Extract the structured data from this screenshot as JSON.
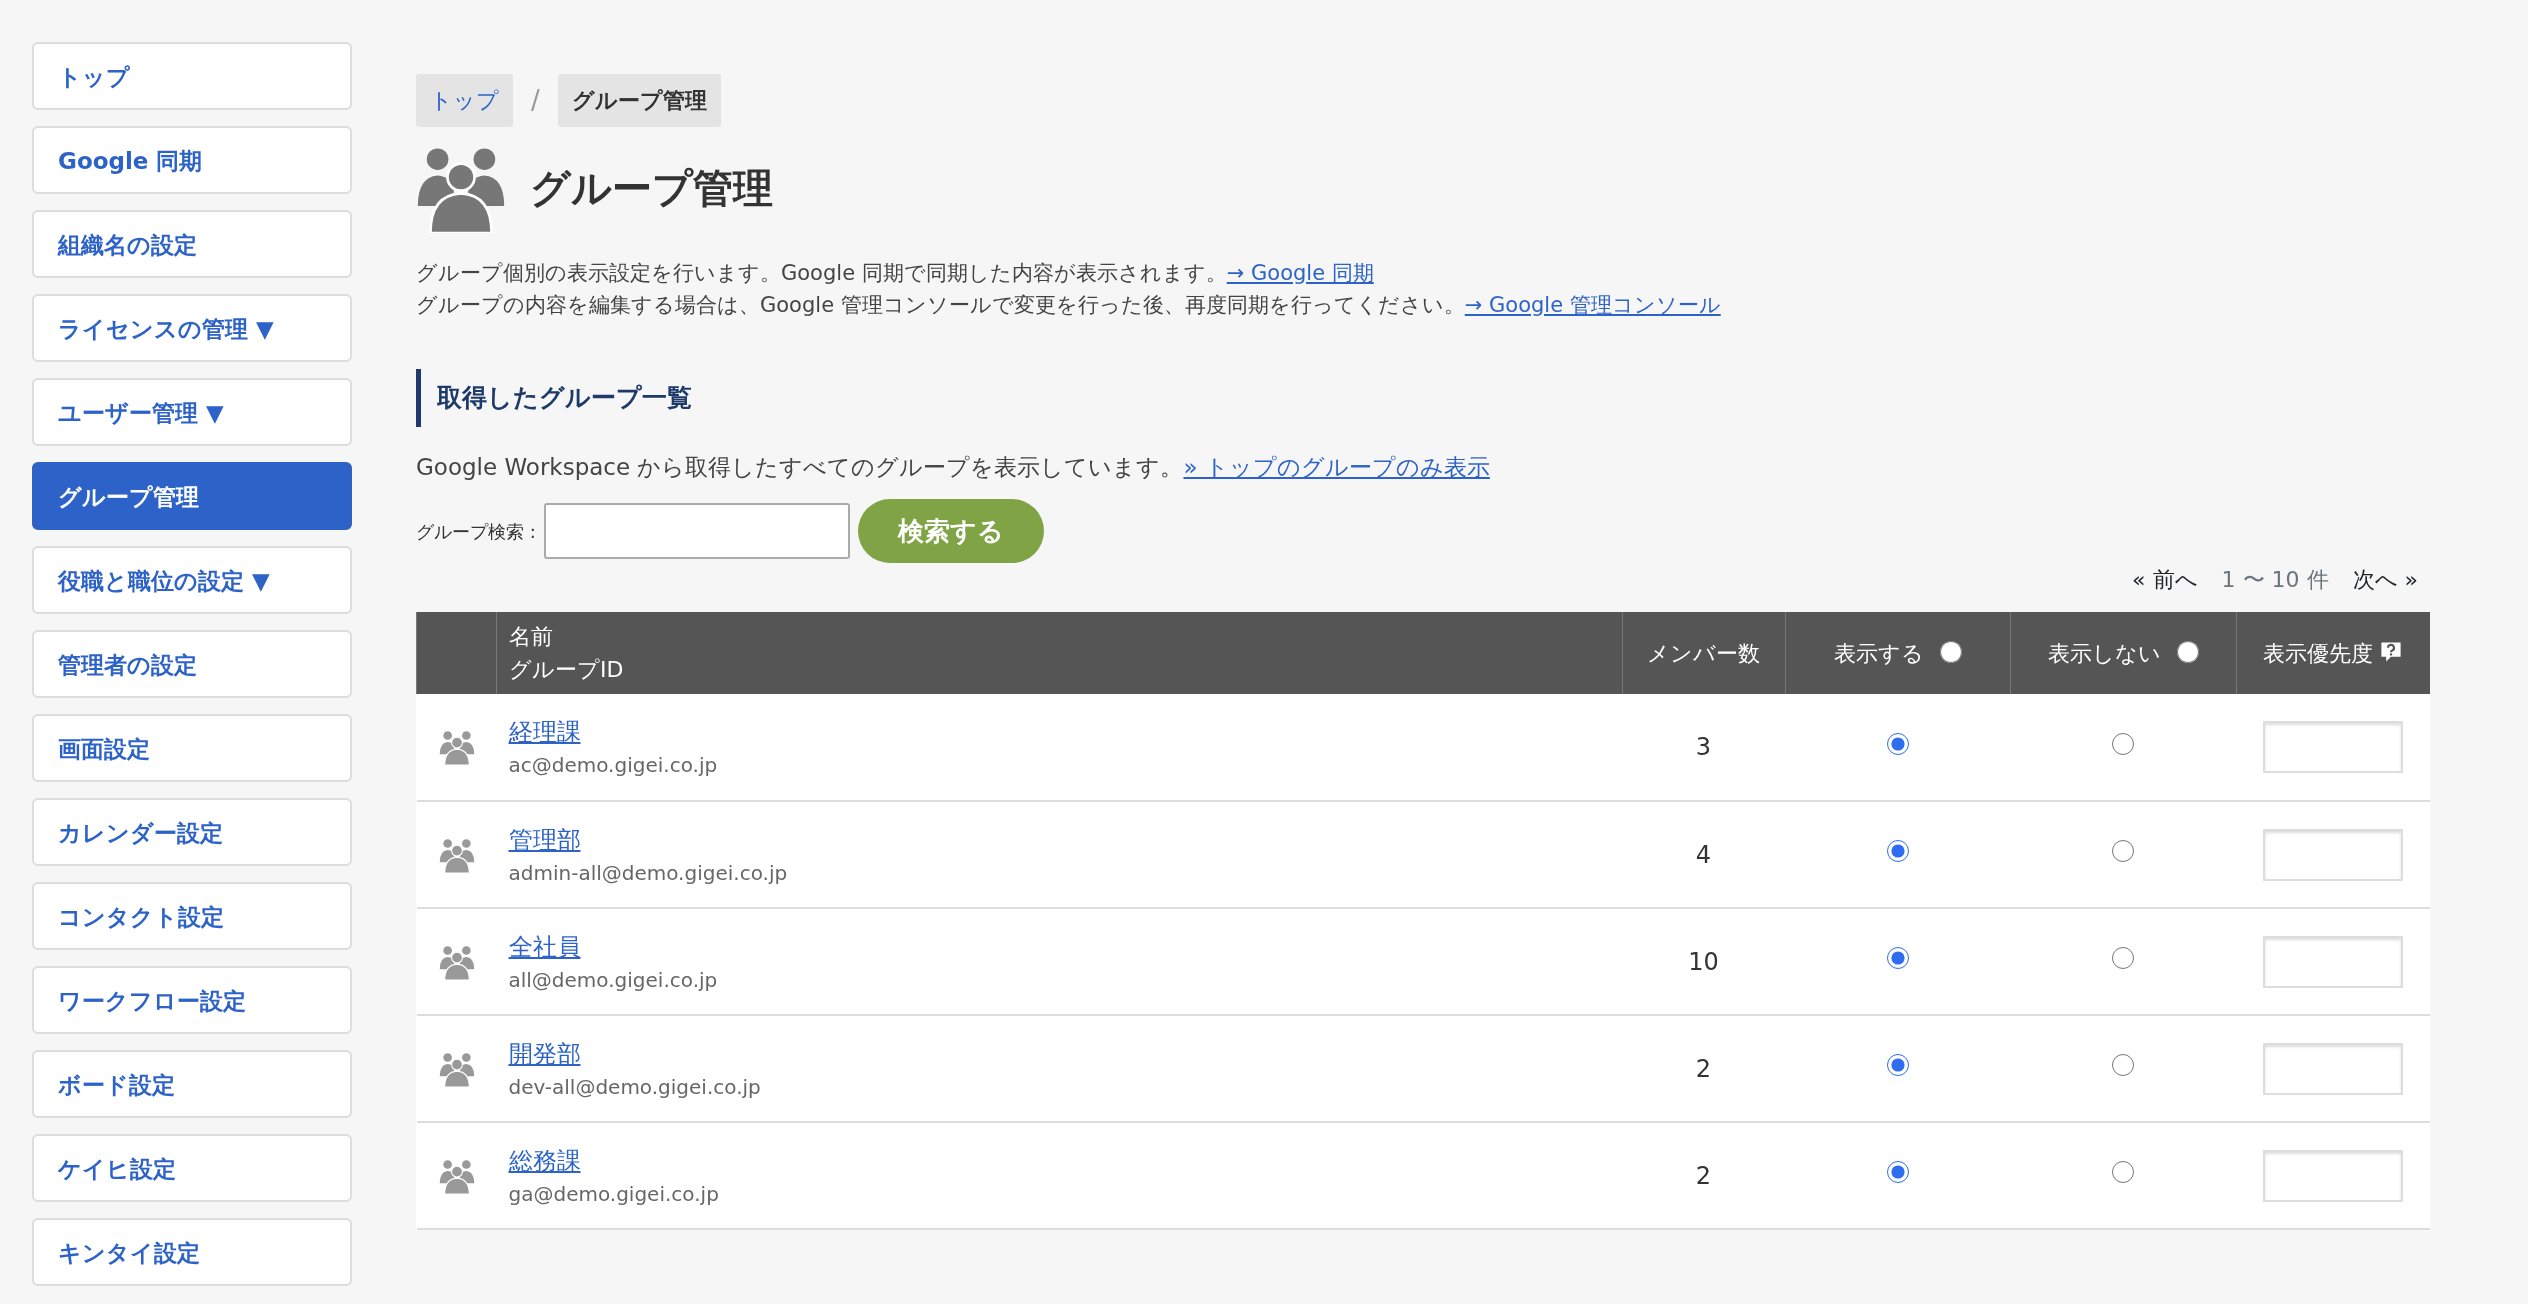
{
  "sidebar": {
    "items": [
      {
        "label": "トップ",
        "selected": false
      },
      {
        "label": "Google 同期",
        "selected": false
      },
      {
        "label": "組織名の設定",
        "selected": false
      },
      {
        "label": "ライセンスの管理 ▼",
        "selected": false
      },
      {
        "label": "ユーザー管理 ▼",
        "selected": false
      },
      {
        "label": "グループ管理",
        "selected": true
      },
      {
        "label": "役職と職位の設定 ▼",
        "selected": false
      },
      {
        "label": "管理者の設定",
        "selected": false
      },
      {
        "label": "画面設定",
        "selected": false
      },
      {
        "label": "カレンダー設定",
        "selected": false
      },
      {
        "label": "コンタクト設定",
        "selected": false
      },
      {
        "label": "ワークフロー設定",
        "selected": false
      },
      {
        "label": "ボード設定",
        "selected": false
      },
      {
        "label": "ケイヒ設定",
        "selected": false
      },
      {
        "label": "キンタイ設定",
        "selected": false
      }
    ]
  },
  "breadcrumb": {
    "separator": "/",
    "items": [
      {
        "label": "トップ",
        "selected": false
      },
      {
        "label": "グループ管理",
        "selected": true
      }
    ]
  },
  "page": {
    "title": "グループ管理",
    "description": [
      {
        "text": "グループ個別の表示設定を行います。Google 同期で同期した内容が表示されます。",
        "link": "→ Google 同期"
      },
      {
        "text": "グループの内容を編集する場合は、Google 管理コンソールで変更を行った後、再度同期を行ってください。",
        "link": "→ Google 管理コンソール"
      }
    ]
  },
  "section": {
    "title": "取得したグループ一覧",
    "note": "Google Workspace から取得したすべてのグループを表示しています。",
    "note_link": "» トップのグループのみ表示"
  },
  "search": {
    "label": "グループ検索 :",
    "button": "検索する"
  },
  "pagination": {
    "prev": "« 前へ",
    "range": "1 〜 10 件",
    "next": "次へ »"
  },
  "table": {
    "columns": {
      "name": "名前",
      "group_id": "グループID",
      "members": "メンバー数",
      "show": "表示する",
      "show_all_checked": false,
      "hide": "表示しない",
      "hide_all_checked": false,
      "priority": "表示優先度"
    },
    "rows": [
      {
        "name": "経理課",
        "group_id": "ac@demo.gigei.co.jp",
        "members": "3",
        "show": true,
        "hide": false
      },
      {
        "name": "管理部",
        "group_id": "admin-all@demo.gigei.co.jp",
        "members": "4",
        "show": true,
        "hide": false
      },
      {
        "name": "全社員",
        "group_id": "all@demo.gigei.co.jp",
        "members": "10",
        "show": true,
        "hide": false
      },
      {
        "name": "開発部",
        "group_id": "dev-all@demo.gigei.co.jp",
        "members": "2",
        "show": true,
        "hide": false
      },
      {
        "name": "総務課",
        "group_id": "ga@demo.gigei.co.jp",
        "members": "2",
        "show": true,
        "hide": false
      }
    ]
  }
}
